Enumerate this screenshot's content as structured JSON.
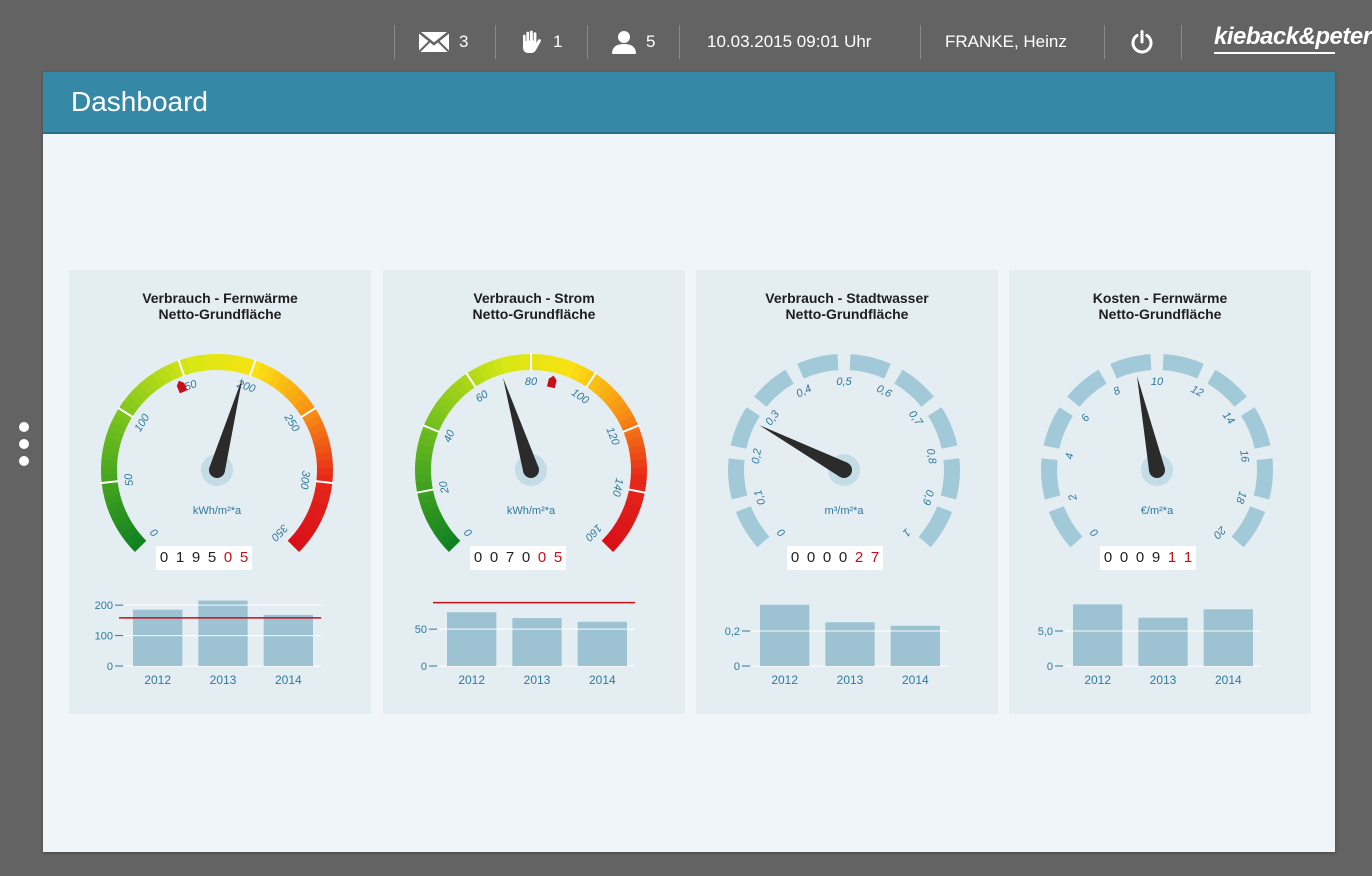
{
  "topbar": {
    "messages_count": "3",
    "alarms_count": "1",
    "users_count": "5",
    "datetime": "10.03.2015  09:01 Uhr",
    "user_name": "FRANKE, Heinz",
    "logo": "kieback&peter"
  },
  "page": {
    "title": "Dashboard"
  },
  "colors": {
    "header": "#3589a6",
    "bar": "#9dc3d3",
    "limit_line": "#c3101a",
    "needle": "#2b2b2b"
  },
  "cards": [
    {
      "title_line1": "Verbrauch - Fernwärme",
      "title_line2": "Netto-Grundfläche",
      "gauge": {
        "unit": "kWh/m²*a",
        "min": 0,
        "max": 350,
        "ticks": [
          "0",
          "50",
          "100",
          "150",
          "200",
          "250",
          "300",
          "350"
        ],
        "value": 195,
        "target_marker": 145,
        "colored": true
      },
      "counter": [
        "0",
        "1",
        "9",
        "5",
        "0",
        "5"
      ],
      "counter_red_from": 4,
      "bar_chart": {
        "categories": [
          "2012",
          "2013",
          "2014"
        ],
        "values": [
          185,
          215,
          168
        ],
        "yticks": [
          "0",
          "100",
          "200"
        ],
        "ytick_values": [
          0,
          100,
          200
        ],
        "ymax": 230,
        "limit": 158
      }
    },
    {
      "title_line1": "Verbrauch - Strom",
      "title_line2": "Netto-Grundfläche",
      "gauge": {
        "unit": "kWh/m²*a",
        "min": 0,
        "max": 160,
        "ticks": [
          "0",
          "20",
          "40",
          "60",
          "80",
          "100",
          "120",
          "140",
          "160"
        ],
        "value": 70,
        "target_marker": 88,
        "colored": true
      },
      "counter": [
        "0",
        "0",
        "7",
        "0",
        "0",
        "5"
      ],
      "counter_red_from": 4,
      "bar_chart": {
        "categories": [
          "2012",
          "2013",
          "2014"
        ],
        "values": [
          73,
          65,
          60
        ],
        "yticks": [
          "0",
          "50"
        ],
        "ytick_values": [
          0,
          50
        ],
        "ymax": 95,
        "limit": 86
      }
    },
    {
      "title_line1": "Verbrauch - Stadtwasser",
      "title_line2": "Netto-Grundfläche",
      "gauge": {
        "unit": "m³/m²*a",
        "min": 0,
        "max": 1,
        "ticks": [
          "0",
          "0,1",
          "0,2",
          "0,3",
          "0,4",
          "0,5",
          "0,6",
          "0,7",
          "0,8",
          "0,9",
          "1"
        ],
        "value": 0.27,
        "colored": false
      },
      "counter": [
        "0",
        "0",
        "0",
        "0",
        "2",
        "7"
      ],
      "counter_red_from": 4,
      "bar_chart": {
        "categories": [
          "2012",
          "2013",
          "2014"
        ],
        "values": [
          0.35,
          0.25,
          0.23
        ],
        "yticks": [
          "0",
          "0,2"
        ],
        "ytick_values": [
          0,
          0.2
        ],
        "ymax": 0.4
      }
    },
    {
      "title_line1": "Kosten - Fernwärme",
      "title_line2": "Netto-Grundfläche",
      "gauge": {
        "unit": "€/m²*a",
        "min": 0,
        "max": 20,
        "ticks": [
          "0",
          "2",
          "4",
          "6",
          "8",
          "10",
          "12",
          "14",
          "16",
          "18",
          "20"
        ],
        "value": 9.11,
        "colored": false
      },
      "counter": [
        "0",
        "0",
        "0",
        "9",
        "1",
        "1"
      ],
      "counter_red_from": 4,
      "bar_chart": {
        "categories": [
          "2012",
          "2013",
          "2014"
        ],
        "values": [
          8.8,
          6.9,
          8.1
        ],
        "yticks": [
          "0",
          "5,0"
        ],
        "ytick_values": [
          0,
          5.0
        ],
        "ymax": 10
      }
    }
  ]
}
